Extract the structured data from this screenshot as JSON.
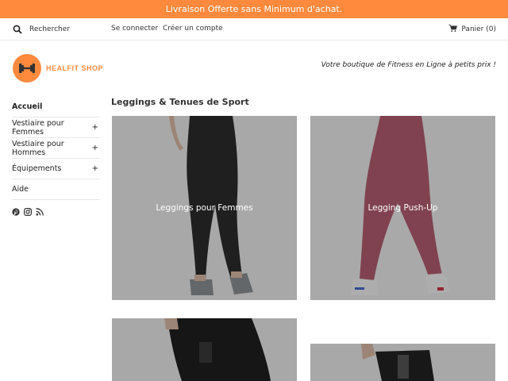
{
  "announcement": "Livraison Offerte sans Minimum d'achat.",
  "topbar": {
    "search_placeholder": "Rechercher",
    "login": "Se connecter",
    "register": "Créer un compte",
    "cart": "Panier (0)"
  },
  "brand": {
    "name": "HEALFIT SHOP",
    "tagline": "Votre boutique de Fitness en Ligne à petits prix !",
    "accent_color": "#ff8a3d"
  },
  "sidebar": {
    "items": [
      {
        "label": "Accueil",
        "plus": ""
      },
      {
        "label": "Vestiaire pour Femmes",
        "plus": "+"
      },
      {
        "label": "Vestiaire pour Hommes",
        "plus": "+"
      },
      {
        "label": "Équipements",
        "plus": "+"
      },
      {
        "label": "Aide",
        "plus": ""
      }
    ],
    "socials": [
      "pinterest-icon",
      "instagram-icon",
      "rss-icon"
    ]
  },
  "main": {
    "title": "Leggings & Tenues de Sport",
    "collections": [
      {
        "label": "Leggings pour Femmes"
      },
      {
        "label": "Legging Push-Up"
      },
      {
        "label": ""
      },
      {
        "label": ""
      }
    ]
  }
}
